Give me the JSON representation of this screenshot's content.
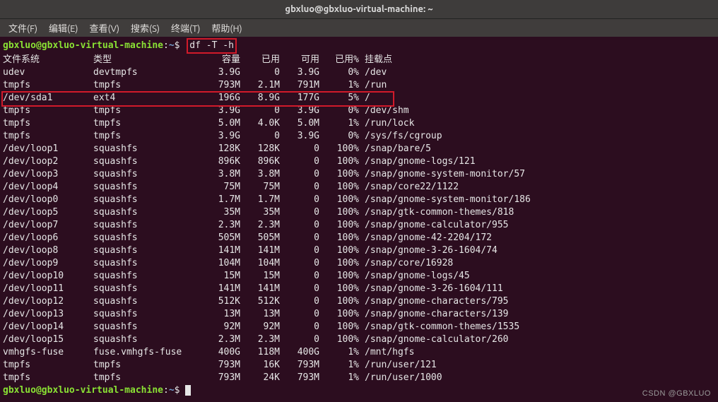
{
  "window": {
    "title": "gbxluo@gbxluo-virtual-machine: ~"
  },
  "menubar": {
    "items": [
      "文件(F)",
      "编辑(E)",
      "查看(V)",
      "搜索(S)",
      "终端(T)",
      "帮助(H)"
    ]
  },
  "prompt": {
    "user_host": "gbxluo@gbxluo-virtual-machine",
    "colon": ":",
    "path": "~",
    "symbol": "$"
  },
  "command": "df -T -h",
  "headers": {
    "fs": "文件系统",
    "type": "类型",
    "size": "容量",
    "used": "已用",
    "avail": "可用",
    "usep": "已用%",
    "mount": "挂载点"
  },
  "rows": [
    {
      "fs": "udev",
      "type": "devtmpfs",
      "size": "3.9G",
      "used": "0",
      "avail": "3.9G",
      "usep": "0%",
      "mount": "/dev",
      "hl": false
    },
    {
      "fs": "tmpfs",
      "type": "tmpfs",
      "size": "793M",
      "used": "2.1M",
      "avail": "791M",
      "usep": "1%",
      "mount": "/run",
      "hl": false
    },
    {
      "fs": "/dev/sda1",
      "type": "ext4",
      "size": "196G",
      "used": "8.9G",
      "avail": "177G",
      "usep": "5%",
      "mount": "/",
      "hl": true
    },
    {
      "fs": "tmpfs",
      "type": "tmpfs",
      "size": "3.9G",
      "used": "0",
      "avail": "3.9G",
      "usep": "0%",
      "mount": "/dev/shm",
      "hl": false
    },
    {
      "fs": "tmpfs",
      "type": "tmpfs",
      "size": "5.0M",
      "used": "4.0K",
      "avail": "5.0M",
      "usep": "1%",
      "mount": "/run/lock",
      "hl": false
    },
    {
      "fs": "tmpfs",
      "type": "tmpfs",
      "size": "3.9G",
      "used": "0",
      "avail": "3.9G",
      "usep": "0%",
      "mount": "/sys/fs/cgroup",
      "hl": false
    },
    {
      "fs": "/dev/loop1",
      "type": "squashfs",
      "size": "128K",
      "used": "128K",
      "avail": "0",
      "usep": "100%",
      "mount": "/snap/bare/5",
      "hl": false
    },
    {
      "fs": "/dev/loop2",
      "type": "squashfs",
      "size": "896K",
      "used": "896K",
      "avail": "0",
      "usep": "100%",
      "mount": "/snap/gnome-logs/121",
      "hl": false
    },
    {
      "fs": "/dev/loop3",
      "type": "squashfs",
      "size": "3.8M",
      "used": "3.8M",
      "avail": "0",
      "usep": "100%",
      "mount": "/snap/gnome-system-monitor/57",
      "hl": false
    },
    {
      "fs": "/dev/loop4",
      "type": "squashfs",
      "size": "75M",
      "used": "75M",
      "avail": "0",
      "usep": "100%",
      "mount": "/snap/core22/1122",
      "hl": false
    },
    {
      "fs": "/dev/loop0",
      "type": "squashfs",
      "size": "1.7M",
      "used": "1.7M",
      "avail": "0",
      "usep": "100%",
      "mount": "/snap/gnome-system-monitor/186",
      "hl": false
    },
    {
      "fs": "/dev/loop5",
      "type": "squashfs",
      "size": "35M",
      "used": "35M",
      "avail": "0",
      "usep": "100%",
      "mount": "/snap/gtk-common-themes/818",
      "hl": false
    },
    {
      "fs": "/dev/loop7",
      "type": "squashfs",
      "size": "2.3M",
      "used": "2.3M",
      "avail": "0",
      "usep": "100%",
      "mount": "/snap/gnome-calculator/955",
      "hl": false
    },
    {
      "fs": "/dev/loop6",
      "type": "squashfs",
      "size": "505M",
      "used": "505M",
      "avail": "0",
      "usep": "100%",
      "mount": "/snap/gnome-42-2204/172",
      "hl": false
    },
    {
      "fs": "/dev/loop8",
      "type": "squashfs",
      "size": "141M",
      "used": "141M",
      "avail": "0",
      "usep": "100%",
      "mount": "/snap/gnome-3-26-1604/74",
      "hl": false
    },
    {
      "fs": "/dev/loop9",
      "type": "squashfs",
      "size": "104M",
      "used": "104M",
      "avail": "0",
      "usep": "100%",
      "mount": "/snap/core/16928",
      "hl": false
    },
    {
      "fs": "/dev/loop10",
      "type": "squashfs",
      "size": "15M",
      "used": "15M",
      "avail": "0",
      "usep": "100%",
      "mount": "/snap/gnome-logs/45",
      "hl": false
    },
    {
      "fs": "/dev/loop11",
      "type": "squashfs",
      "size": "141M",
      "used": "141M",
      "avail": "0",
      "usep": "100%",
      "mount": "/snap/gnome-3-26-1604/111",
      "hl": false
    },
    {
      "fs": "/dev/loop12",
      "type": "squashfs",
      "size": "512K",
      "used": "512K",
      "avail": "0",
      "usep": "100%",
      "mount": "/snap/gnome-characters/795",
      "hl": false
    },
    {
      "fs": "/dev/loop13",
      "type": "squashfs",
      "size": "13M",
      "used": "13M",
      "avail": "0",
      "usep": "100%",
      "mount": "/snap/gnome-characters/139",
      "hl": false
    },
    {
      "fs": "/dev/loop14",
      "type": "squashfs",
      "size": "92M",
      "used": "92M",
      "avail": "0",
      "usep": "100%",
      "mount": "/snap/gtk-common-themes/1535",
      "hl": false
    },
    {
      "fs": "/dev/loop15",
      "type": "squashfs",
      "size": "2.3M",
      "used": "2.3M",
      "avail": "0",
      "usep": "100%",
      "mount": "/snap/gnome-calculator/260",
      "hl": false
    },
    {
      "fs": "vmhgfs-fuse",
      "type": "fuse.vmhgfs-fuse",
      "size": "400G",
      "used": "118M",
      "avail": "400G",
      "usep": "1%",
      "mount": "/mnt/hgfs",
      "hl": false
    },
    {
      "fs": "tmpfs",
      "type": "tmpfs",
      "size": "793M",
      "used": "16K",
      "avail": "793M",
      "usep": "1%",
      "mount": "/run/user/121",
      "hl": false
    },
    {
      "fs": "tmpfs",
      "type": "tmpfs",
      "size": "793M",
      "used": "24K",
      "avail": "793M",
      "usep": "1%",
      "mount": "/run/user/1000",
      "hl": false
    }
  ],
  "watermark": "CSDN @GBXLUO"
}
